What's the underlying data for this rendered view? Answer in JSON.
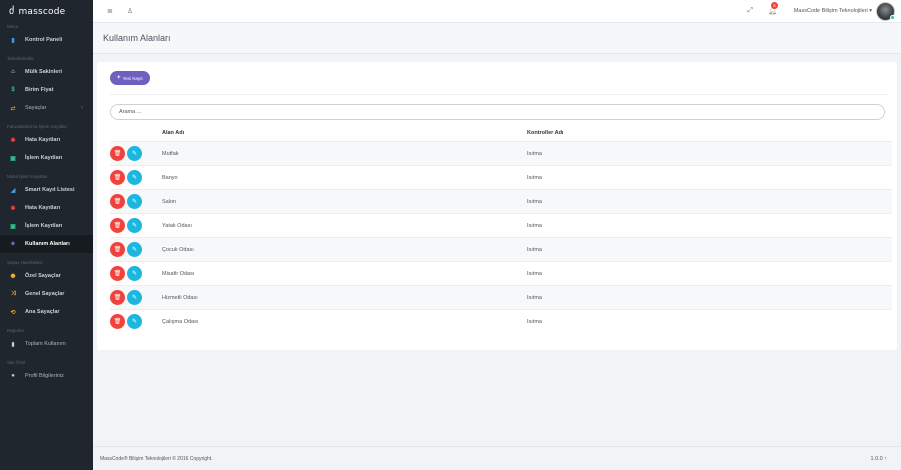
{
  "app": {
    "logo": "masscode",
    "logo_icon": "masscode-logo-icon"
  },
  "sidebar": {
    "sections": [
      {
        "title": "Menu",
        "items": [
          {
            "label": "Kontrol Paneli",
            "icon": "bar-chart-icon",
            "glyph": "▮",
            "color": "#3d9be9",
            "bold": true
          }
        ]
      },
      {
        "title": "Tanımlamalar",
        "items": [
          {
            "label": "Mülk Sakinleri",
            "icon": "home-icon",
            "glyph": "⌂",
            "color": "#ffffff",
            "bold": true
          },
          {
            "label": "Birim Fiyat",
            "icon": "dollar-icon",
            "glyph": "$",
            "color": "#34c38f",
            "bold": true
          },
          {
            "label": "Sayaçlar",
            "icon": "exchange-icon",
            "glyph": "⇄",
            "color": "#f5b225",
            "bold": false,
            "caret": "‹"
          }
        ]
      },
      {
        "title": "Faturalandırma İşlem Kayıtları",
        "items": [
          {
            "label": "Hata Kayıtları",
            "icon": "bug-icon",
            "glyph": "✱",
            "color": "#f0433e",
            "bold": true
          },
          {
            "label": "İşlem Kayıtları",
            "icon": "list-icon",
            "glyph": "▣",
            "color": "#34c38f",
            "bold": true
          }
        ]
      },
      {
        "title": "Mobil İşlem Kayıtları",
        "items": [
          {
            "label": "Smart Kayıt Listesi",
            "icon": "chart-icon",
            "glyph": "◢",
            "color": "#3d9be9",
            "bold": true
          },
          {
            "label": "Hata Kayıtları",
            "icon": "bug-icon",
            "glyph": "✱",
            "color": "#f0433e",
            "bold": true
          },
          {
            "label": "İşlem Kayıtları",
            "icon": "list-icon",
            "glyph": "▣",
            "color": "#34c38f",
            "bold": true
          },
          {
            "label": "Kullanım Alanları",
            "icon": "tag-icon",
            "glyph": "⬥",
            "color": "#6f5fbf",
            "bold": true,
            "active": true
          }
        ]
      },
      {
        "title": "Sayaç Hareketleri",
        "items": [
          {
            "label": "Özel Sayaçlar",
            "icon": "settings-icon",
            "glyph": "✺",
            "color": "#f5b225",
            "bold": true
          },
          {
            "label": "Genel Sayaçlar",
            "icon": "shuffle-icon",
            "glyph": "⤨",
            "color": "#f5b225",
            "bold": true
          },
          {
            "label": "Ana Sayaçlar",
            "icon": "repeat-icon",
            "glyph": "⟲",
            "color": "#f5b225",
            "bold": true
          }
        ]
      },
      {
        "title": "Raporlar",
        "items": [
          {
            "label": "Toplam Kullanım",
            "icon": "bar-chart-icon",
            "glyph": "▮",
            "color": "#c9d1d8",
            "bold": false
          }
        ]
      },
      {
        "title": "Site Özel",
        "items": [
          {
            "label": "Profil Bilgileriniz",
            "icon": "user-icon",
            "glyph": "●",
            "color": "#c9d1d8",
            "bold": false
          }
        ]
      }
    ]
  },
  "topbar": {
    "menu_icon": "≣",
    "user_icon": "♙",
    "expand_icon": "⤢",
    "notifications": "5",
    "user_name": "MassCode Bilişim Teknolojileri"
  },
  "page": {
    "title": "Kullanım Alanları",
    "new_button": "Yeni Kayıt",
    "search_placeholder": "Arama ...",
    "columns": [
      "Alan Adı",
      "Kontroller Adı"
    ],
    "rows": [
      {
        "area": "Mutfak",
        "controller": "Isıtma"
      },
      {
        "area": "Banyo",
        "controller": "Isıtma"
      },
      {
        "area": "Salon",
        "controller": "Isıtma"
      },
      {
        "area": "Yatak Odası",
        "controller": "Isıtma"
      },
      {
        "area": "Çocuk Odası",
        "controller": "Isıtma"
      },
      {
        "area": "Misafir Odası",
        "controller": "Isıtma"
      },
      {
        "area": "Hizmetli Odası",
        "controller": "Isıtma"
      },
      {
        "area": "Çalışma Odası",
        "controller": "Isıtma"
      }
    ]
  },
  "footer": {
    "copyright": "MassCode® Bilişim Teknolojileri © 2016 Copyright.",
    "version": "1.0.0"
  },
  "colors": {
    "sidebar_bg": "#1f262d",
    "primary": "#6f5fbf",
    "danger": "#f0433e",
    "info": "#1bb7df"
  }
}
